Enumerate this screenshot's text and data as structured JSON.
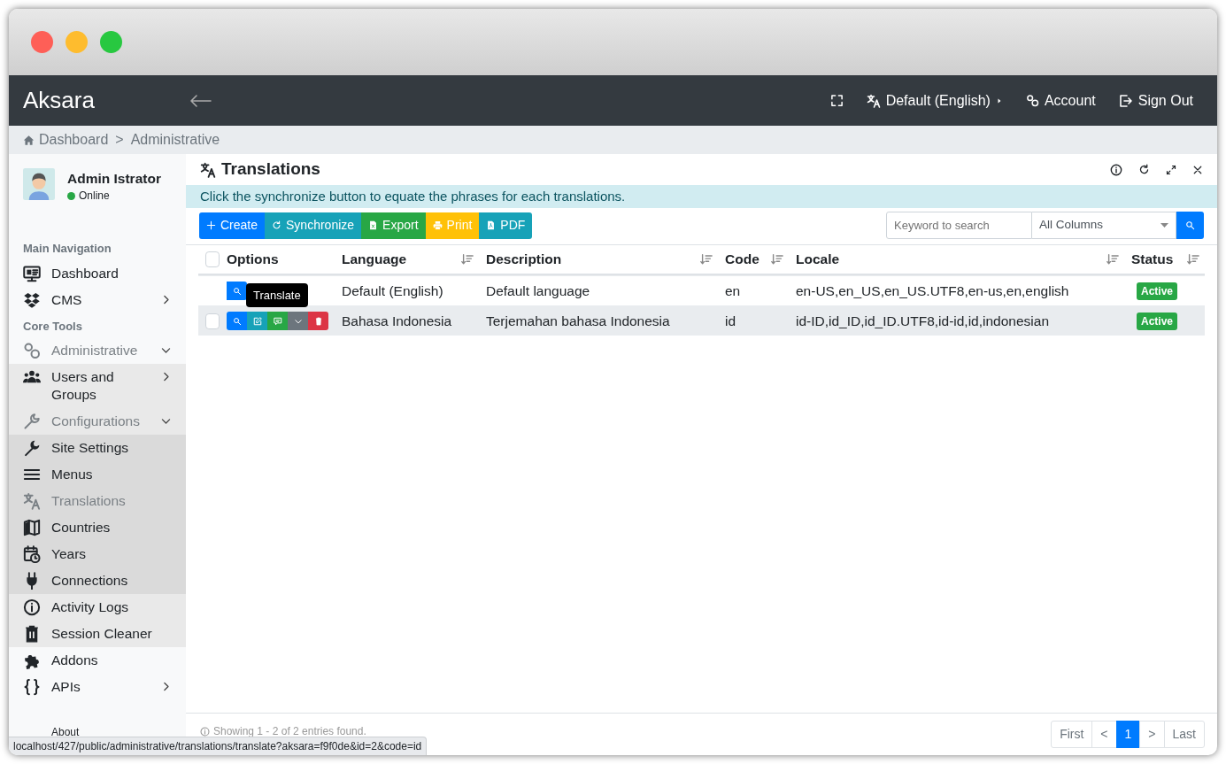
{
  "navbar": {
    "brand": "Aksara",
    "items": [
      {
        "kind": "language",
        "label": "Default (English)"
      },
      {
        "kind": "account",
        "label": "Account"
      },
      {
        "kind": "signout",
        "label": "Sign Out"
      }
    ]
  },
  "breadcrumb": {
    "separator": ">",
    "items": [
      {
        "label": "Dashboard"
      },
      {
        "label": "Administrative"
      }
    ]
  },
  "user": {
    "name": "Admin Istrator",
    "status": "Online",
    "online": true
  },
  "sidebar": {
    "items": [
      {
        "kind": "header",
        "label": "Main Navigation"
      },
      {
        "kind": "link",
        "label": "Dashboard",
        "selected": false
      },
      {
        "kind": "link",
        "label": "CMS",
        "selected": false,
        "expanded": false
      },
      {
        "kind": "header",
        "label": "Core Tools"
      },
      {
        "kind": "link",
        "label": "Administrative",
        "expanded": true,
        "children": [
          {
            "kind": "link",
            "label": "Users and Groups",
            "selected": false,
            "expanded": false
          },
          {
            "kind": "link",
            "label": "Configurations",
            "expanded": true,
            "children": [
              {
                "kind": "link",
                "label": "Site Settings",
                "selected": false
              },
              {
                "kind": "link",
                "label": "Menus",
                "selected": false
              },
              {
                "kind": "link",
                "label": "Translations",
                "selected": true
              },
              {
                "kind": "link",
                "label": "Countries",
                "selected": false
              },
              {
                "kind": "link",
                "label": "Years",
                "selected": false
              },
              {
                "kind": "link",
                "label": "Connections",
                "selected": false
              }
            ]
          },
          {
            "kind": "link",
            "label": "Activity Logs",
            "selected": false
          },
          {
            "kind": "link",
            "label": "Session Cleaner",
            "selected": false
          }
        ]
      },
      {
        "kind": "link",
        "label": "Addons",
        "selected": false
      },
      {
        "kind": "link",
        "label": "APIs",
        "selected": false,
        "expanded": false
      },
      {
        "kind": "note",
        "label": "About"
      }
    ]
  },
  "page": {
    "title": "Translations",
    "notice": "Click the synchronize button to equate the phrases for each translations.",
    "toolbar": [
      {
        "kind": "create",
        "label": "Create"
      },
      {
        "kind": "synchronize",
        "label": "Synchronize"
      },
      {
        "kind": "export",
        "label": "Export"
      },
      {
        "kind": "print",
        "label": "Print"
      },
      {
        "kind": "pdf",
        "label": "PDF"
      }
    ],
    "search": {
      "placeholder": "Keyword to search"
    },
    "column_filter": {
      "value": "All Columns"
    }
  },
  "table": {
    "select_all_checked": false,
    "columns": [
      {
        "label": "Options",
        "sortable": false
      },
      {
        "label": "Language",
        "sortable": true
      },
      {
        "label": "Description",
        "sortable": true
      },
      {
        "label": "Code",
        "sortable": true
      },
      {
        "label": "Locale",
        "sortable": true
      },
      {
        "label": "Status",
        "sortable": true
      }
    ],
    "rows": [
      {
        "selectable": false,
        "hovered": false,
        "actions": [
          {
            "kind": "view"
          }
        ],
        "language": "Default (English)",
        "description": "Default language",
        "code": "en",
        "locale": "en-US,en_US,en_US.UTF8,en-us,en,english",
        "status": {
          "label": "Active",
          "active": true
        }
      },
      {
        "selectable": true,
        "checked": false,
        "hovered": true,
        "actions": [
          {
            "kind": "view"
          },
          {
            "kind": "edit"
          },
          {
            "kind": "translate",
            "tooltip": "Translate"
          },
          {
            "kind": "more"
          },
          {
            "kind": "delete"
          }
        ],
        "language": "Bahasa Indonesia",
        "description": "Terjemahan bahasa Indonesia",
        "code": "id",
        "locale": "id-ID,id_ID,id_ID.UTF8,id-id,id,indonesian",
        "status": {
          "label": "Active",
          "active": true
        }
      }
    ]
  },
  "footer": {
    "summary": "Showing 1 - 2 of 2 entries found.",
    "pagination": [
      {
        "label": "First",
        "selected": false
      },
      {
        "label": "<",
        "selected": false
      },
      {
        "label": "1",
        "selected": true
      },
      {
        "label": ">",
        "selected": false
      },
      {
        "label": "Last",
        "selected": false
      }
    ]
  },
  "status_url": "localhost/427/public/administrative/translations/translate?aksara=f9f0de&id=2&code=id"
}
